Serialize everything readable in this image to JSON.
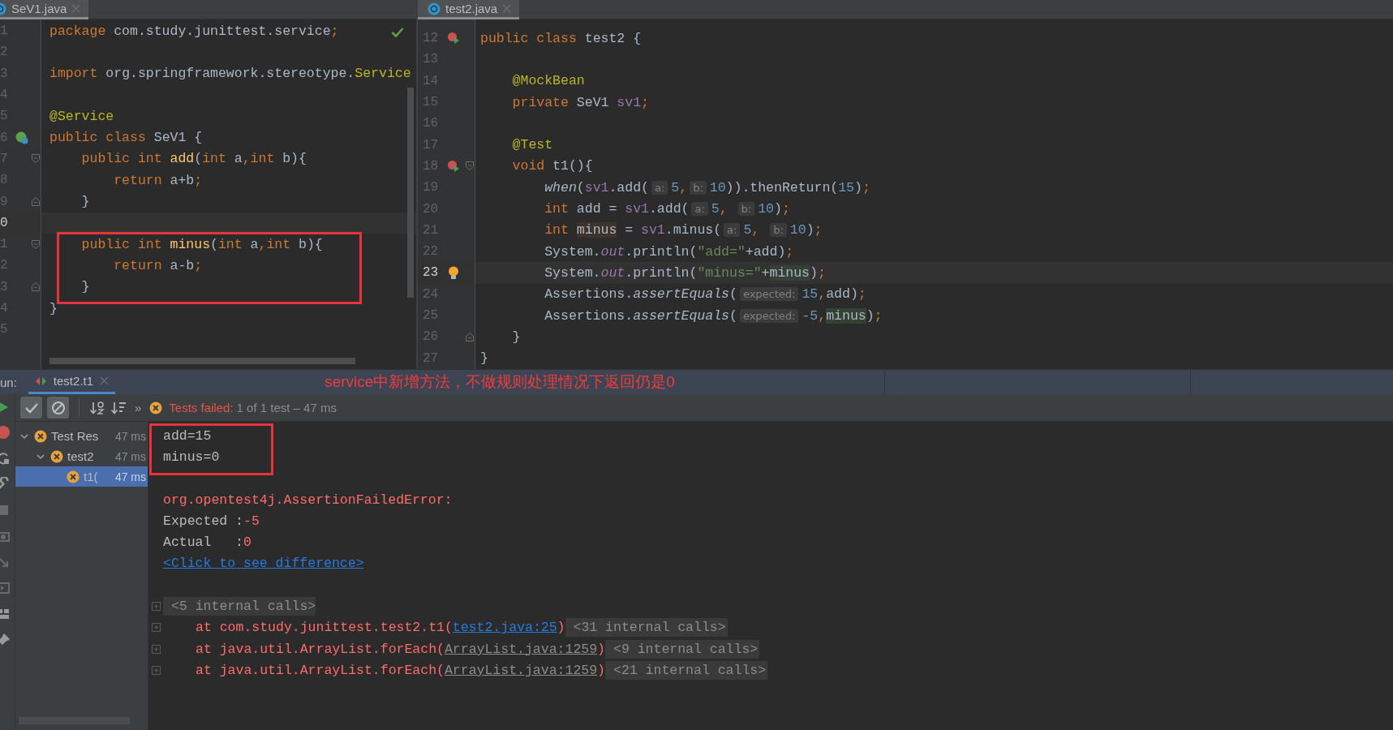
{
  "left_editor": {
    "tabs": [
      {
        "label": "SeV1.java",
        "selected": true
      }
    ],
    "lines": [
      {
        "number": "1",
        "current": false,
        "framed": false,
        "tokens": [
          {
            "kind": "keyword",
            "text": "package"
          },
          {
            "kind": "plain",
            "text": " com.study.junittest.service"
          },
          {
            "kind": "keyword",
            "text": ";"
          }
        ]
      },
      {
        "number": "2",
        "current": false,
        "framed": false
      },
      {
        "number": "3",
        "current": false,
        "framed": false,
        "tokens": [
          {
            "kind": "keyword",
            "text": "import"
          },
          {
            "kind": "plain",
            "text": " org.springframework.stereotype."
          },
          {
            "kind": "annotation",
            "text": "Service"
          }
        ]
      },
      {
        "number": "4",
        "current": false,
        "framed": false
      },
      {
        "number": "5",
        "current": false,
        "framed": false,
        "tokens": [
          {
            "kind": "annotation",
            "text": "@Service"
          }
        ]
      },
      {
        "number": "6",
        "current": false,
        "framed": false,
        "gutter_icon": {
          "kind": "bean"
        },
        "tokens": [
          {
            "kind": "keyword",
            "text": "public class"
          },
          {
            "kind": "plain",
            "text": " SeV1 {"
          }
        ]
      },
      {
        "number": "7",
        "current": false,
        "framed": false,
        "fold_marker": {
          "kind": "start"
        },
        "tokens": [
          {
            "kind": "keyword",
            "text": "    public int "
          },
          {
            "kind": "method",
            "text": "add"
          },
          {
            "kind": "plain",
            "text": "("
          },
          {
            "kind": "keyword",
            "text": "int"
          },
          {
            "kind": "plain",
            "text": " a"
          },
          {
            "kind": "keyword",
            "text": ","
          },
          {
            "kind": "keyword",
            "text": "int"
          },
          {
            "kind": "plain",
            "text": " b){"
          }
        ]
      },
      {
        "number": "8",
        "current": false,
        "framed": false,
        "tokens": [
          {
            "kind": "keyword",
            "text": "        return"
          },
          {
            "kind": "plain",
            "text": " a+b"
          },
          {
            "kind": "keyword",
            "text": ";"
          }
        ]
      },
      {
        "number": "9",
        "current": false,
        "framed": false,
        "fold_marker": {
          "kind": "end"
        },
        "tokens": [
          {
            "kind": "plain",
            "text": "    }"
          }
        ]
      },
      {
        "number": "0",
        "current": true,
        "framed": false
      },
      {
        "number": "1",
        "current": false,
        "framed": true,
        "fold_marker": {
          "kind": "start"
        },
        "tokens": [
          {
            "kind": "keyword",
            "text": "    public int "
          },
          {
            "kind": "method",
            "text": "minus"
          },
          {
            "kind": "plain",
            "text": "("
          },
          {
            "kind": "keyword",
            "text": "int"
          },
          {
            "kind": "plain",
            "text": " a"
          },
          {
            "kind": "keyword",
            "text": ","
          },
          {
            "kind": "keyword",
            "text": "int"
          },
          {
            "kind": "plain",
            "text": " b){"
          }
        ]
      },
      {
        "number": "2",
        "current": false,
        "framed": true,
        "tokens": [
          {
            "kind": "keyword",
            "text": "        return"
          },
          {
            "kind": "plain",
            "text": " a-b"
          },
          {
            "kind": "keyword",
            "text": ";"
          }
        ]
      },
      {
        "number": "3",
        "current": false,
        "framed": true,
        "fold_marker": {
          "kind": "end"
        },
        "tokens": [
          {
            "kind": "plain",
            "text": "    }"
          }
        ]
      },
      {
        "number": "4",
        "current": false,
        "framed": false,
        "tokens": [
          {
            "kind": "plain",
            "text": "}"
          }
        ]
      },
      {
        "number": "5",
        "current": false,
        "framed": false
      }
    ]
  },
  "right_editor": {
    "tabs": [
      {
        "label": "test2.java",
        "selected": true
      }
    ],
    "lines": [
      {
        "number": "12",
        "current": false,
        "gutter_icon": {
          "kind": "run_failed"
        },
        "tokens": [
          {
            "kind": "keyword",
            "text": "public class"
          },
          {
            "kind": "plain",
            "text": " test2 {"
          }
        ]
      },
      {
        "number": "13",
        "current": false
      },
      {
        "number": "14",
        "current": false,
        "tokens": [
          {
            "kind": "annotation",
            "text": "    @MockBean"
          }
        ]
      },
      {
        "number": "15",
        "current": false,
        "tokens": [
          {
            "kind": "keyword",
            "text": "    private"
          },
          {
            "kind": "plain",
            "text": " SeV1 "
          },
          {
            "kind": "field",
            "text": "sv1"
          },
          {
            "kind": "keyword",
            "text": ";"
          }
        ]
      },
      {
        "number": "16",
        "current": false
      },
      {
        "number": "17",
        "current": false,
        "tokens": [
          {
            "kind": "annotation",
            "text": "    @Test"
          }
        ]
      },
      {
        "number": "18",
        "current": false,
        "gutter_icon": {
          "kind": "run_failed"
        },
        "fold_marker": {
          "kind": "start"
        },
        "tokens": [
          {
            "kind": "keyword",
            "text": "    void"
          },
          {
            "kind": "plain",
            "text": " t1(){"
          }
        ]
      },
      {
        "number": "19",
        "current": false,
        "tokens": [
          {
            "kind": "static_call",
            "text": "        when"
          },
          {
            "kind": "plain",
            "text": "("
          },
          {
            "kind": "field",
            "text": "sv1"
          },
          {
            "kind": "plain",
            "text": ".add("
          },
          {
            "kind": "hint",
            "text": "a:"
          },
          {
            "kind": "number",
            "text": "5"
          },
          {
            "kind": "keyword",
            "text": ","
          },
          {
            "kind": "hint",
            "text": "b:"
          },
          {
            "kind": "number",
            "text": "10"
          },
          {
            "kind": "plain",
            "text": ")).thenReturn("
          },
          {
            "kind": "number",
            "text": "15"
          },
          {
            "kind": "plain",
            "text": ")"
          },
          {
            "kind": "keyword",
            "text": ";"
          }
        ]
      },
      {
        "number": "20",
        "current": false,
        "tokens": [
          {
            "kind": "keyword",
            "text": "        int"
          },
          {
            "kind": "plain",
            "text": " add = "
          },
          {
            "kind": "field",
            "text": "sv1"
          },
          {
            "kind": "plain",
            "text": ".add("
          },
          {
            "kind": "hint",
            "text": "a:"
          },
          {
            "kind": "number",
            "text": "5"
          },
          {
            "kind": "keyword",
            "text": ", "
          },
          {
            "kind": "hint",
            "text": "b:"
          },
          {
            "kind": "number",
            "text": "10"
          },
          {
            "kind": "plain",
            "text": ")"
          },
          {
            "kind": "keyword",
            "text": ";"
          }
        ]
      },
      {
        "number": "21",
        "current": false,
        "tokens": [
          {
            "kind": "keyword",
            "text": "        int "
          },
          {
            "kind": "write_usage",
            "text": "minus"
          },
          {
            "kind": "plain",
            "text": " = "
          },
          {
            "kind": "field",
            "text": "sv1"
          },
          {
            "kind": "plain",
            "text": ".minus("
          },
          {
            "kind": "hint",
            "text": "a:"
          },
          {
            "kind": "number",
            "text": "5"
          },
          {
            "kind": "keyword",
            "text": ", "
          },
          {
            "kind": "hint",
            "text": "b:"
          },
          {
            "kind": "number",
            "text": "10"
          },
          {
            "kind": "plain",
            "text": ")"
          },
          {
            "kind": "keyword",
            "text": ";"
          }
        ]
      },
      {
        "number": "22",
        "current": false,
        "tokens": [
          {
            "kind": "plain",
            "text": "        System."
          },
          {
            "kind": "static_field",
            "text": "out"
          },
          {
            "kind": "plain",
            "text": ".println("
          },
          {
            "kind": "string",
            "text": "\"add=\""
          },
          {
            "kind": "plain",
            "text": "+add)"
          },
          {
            "kind": "keyword",
            "text": ";"
          }
        ]
      },
      {
        "number": "23",
        "current": true,
        "gutter_icon": {
          "kind": "bulb"
        },
        "tokens": [
          {
            "kind": "plain",
            "text": "        System."
          },
          {
            "kind": "static_field",
            "text": "out"
          },
          {
            "kind": "plain",
            "text": ".println("
          },
          {
            "kind": "string",
            "text": "\"minus=\""
          },
          {
            "kind": "plain",
            "text": "+"
          },
          {
            "kind": "read_usage",
            "text": "minus"
          },
          {
            "kind": "plain",
            "text": ")"
          },
          {
            "kind": "keyword",
            "text": ";"
          }
        ]
      },
      {
        "number": "24",
        "current": false,
        "tokens": [
          {
            "kind": "plain",
            "text": "        Assertions."
          },
          {
            "kind": "static_call",
            "text": "assertEquals"
          },
          {
            "kind": "plain",
            "text": "("
          },
          {
            "kind": "hint",
            "text": "expected:"
          },
          {
            "kind": "number",
            "text": "15"
          },
          {
            "kind": "keyword",
            "text": ","
          },
          {
            "kind": "plain",
            "text": "add)"
          },
          {
            "kind": "keyword",
            "text": ";"
          }
        ]
      },
      {
        "number": "25",
        "current": false,
        "tokens": [
          {
            "kind": "plain",
            "text": "        Assertions."
          },
          {
            "kind": "static_call",
            "text": "assertEquals"
          },
          {
            "kind": "plain",
            "text": "("
          },
          {
            "kind": "hint",
            "text": "expected:"
          },
          {
            "kind": "number",
            "text": "-5"
          },
          {
            "kind": "keyword",
            "text": ","
          },
          {
            "kind": "read_usage",
            "text": "minus"
          },
          {
            "kind": "plain",
            "text": ")"
          },
          {
            "kind": "keyword",
            "text": ";"
          }
        ]
      },
      {
        "number": "26",
        "current": false,
        "fold_marker": {
          "kind": "end"
        },
        "tokens": [
          {
            "kind": "plain",
            "text": "    }"
          }
        ]
      },
      {
        "number": "27",
        "current": false,
        "tokens": [
          {
            "kind": "plain",
            "text": "}"
          }
        ]
      }
    ]
  },
  "run_panel": {
    "label": "un:",
    "tabs": [
      {
        "label": "test2.t1",
        "selected": true
      }
    ],
    "note": "service中新增方法，不做规则处理情况下返回仍是0",
    "toolbar": {
      "buttons": [
        {
          "kind": "show_passed",
          "selected": true
        },
        {
          "kind": "show_ignored",
          "selected": true
        }
      ],
      "overflow": "»",
      "status": {
        "kind": "failed",
        "label": "Tests failed:",
        "detail": "1 of 1 test – 47 ms"
      }
    },
    "tree": [
      {
        "label": "Test Res",
        "time": "47 ms",
        "kind": "failed",
        "expanded": true,
        "selected": false,
        "children": [
          {
            "label": "test2",
            "time": "47 ms",
            "kind": "failed",
            "expanded": true,
            "selected": false,
            "children": [
              {
                "label": "t1(",
                "time": "47 ms",
                "kind": "failed",
                "selected": true
              }
            ]
          }
        ]
      }
    ],
    "console": [
      {
        "kind": "output",
        "text": "add=15",
        "framed": true
      },
      {
        "kind": "output",
        "text": "minus=0",
        "framed": true
      },
      {
        "kind": "error",
        "text": "org.opentest4j.AssertionFailedError:",
        "framed": false
      },
      {
        "kind": "compare",
        "label": "Expected :",
        "value": "-5",
        "framed": false
      },
      {
        "kind": "compare",
        "label": "Actual   :",
        "value": "0",
        "framed": false
      },
      {
        "kind": "link",
        "text": "<Click to see difference>",
        "framed": false
      },
      {
        "kind": "folded",
        "text": "<5 internal calls>",
        "framed": false
      },
      {
        "kind": "frame",
        "text": "at com.study.junittest.test2.t1(",
        "link": {
          "kind": "project",
          "text": "test2.java:25"
        },
        "after": ")",
        "folded": "<31 internal calls>",
        "framed": false
      },
      {
        "kind": "frame",
        "text": "at java.util.ArrayList.forEach(",
        "link": {
          "kind": "library",
          "text": "ArrayList.java:1259"
        },
        "after": ")",
        "folded": "<9 internal calls>",
        "framed": false
      },
      {
        "kind": "frame",
        "text": "at java.util.ArrayList.forEach(",
        "link": {
          "kind": "library",
          "text": "ArrayList.java:1259"
        },
        "after": ")",
        "folded": "<21 internal calls>",
        "framed": false
      }
    ]
  }
}
